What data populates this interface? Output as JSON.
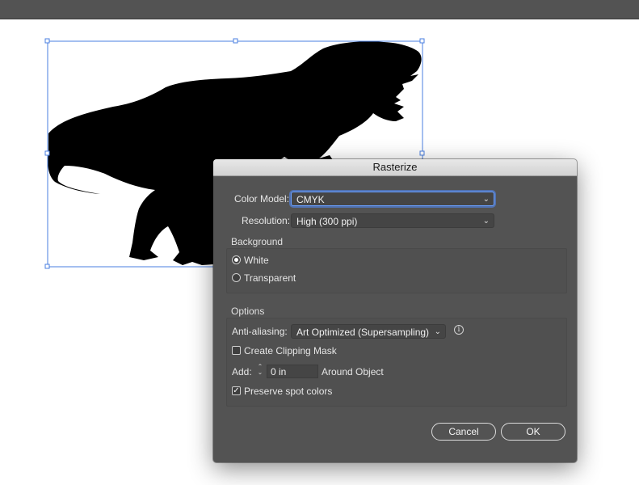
{
  "dialog": {
    "title": "Rasterize",
    "color_model": {
      "label": "Color Model:",
      "value": "CMYK"
    },
    "resolution": {
      "label": "Resolution:",
      "value": "High (300 ppi)"
    },
    "background": {
      "title": "Background",
      "options": [
        {
          "label": "White",
          "selected": true
        },
        {
          "label": "Transparent",
          "selected": false
        }
      ]
    },
    "options": {
      "title": "Options",
      "anti_aliasing": {
        "label": "Anti-aliasing:",
        "value": "Art Optimized (Supersampling)"
      },
      "clipping_mask": {
        "label": "Create Clipping Mask",
        "checked": false
      },
      "add": {
        "label": "Add:",
        "value": "0 in",
        "suffix": "Around Object"
      },
      "preserve_spot": {
        "label": "Preserve spot colors",
        "checked": true
      }
    },
    "cancel_label": "Cancel",
    "ok_label": "OK"
  },
  "colors": {
    "dialog_bg": "#535353",
    "selection": "#4a7fe0",
    "focus": "#6aa0ff",
    "artwork": "#000000"
  },
  "icons": [
    "chevron-down-icon",
    "info-icon",
    "stepper-icon",
    "checkmark-icon"
  ]
}
